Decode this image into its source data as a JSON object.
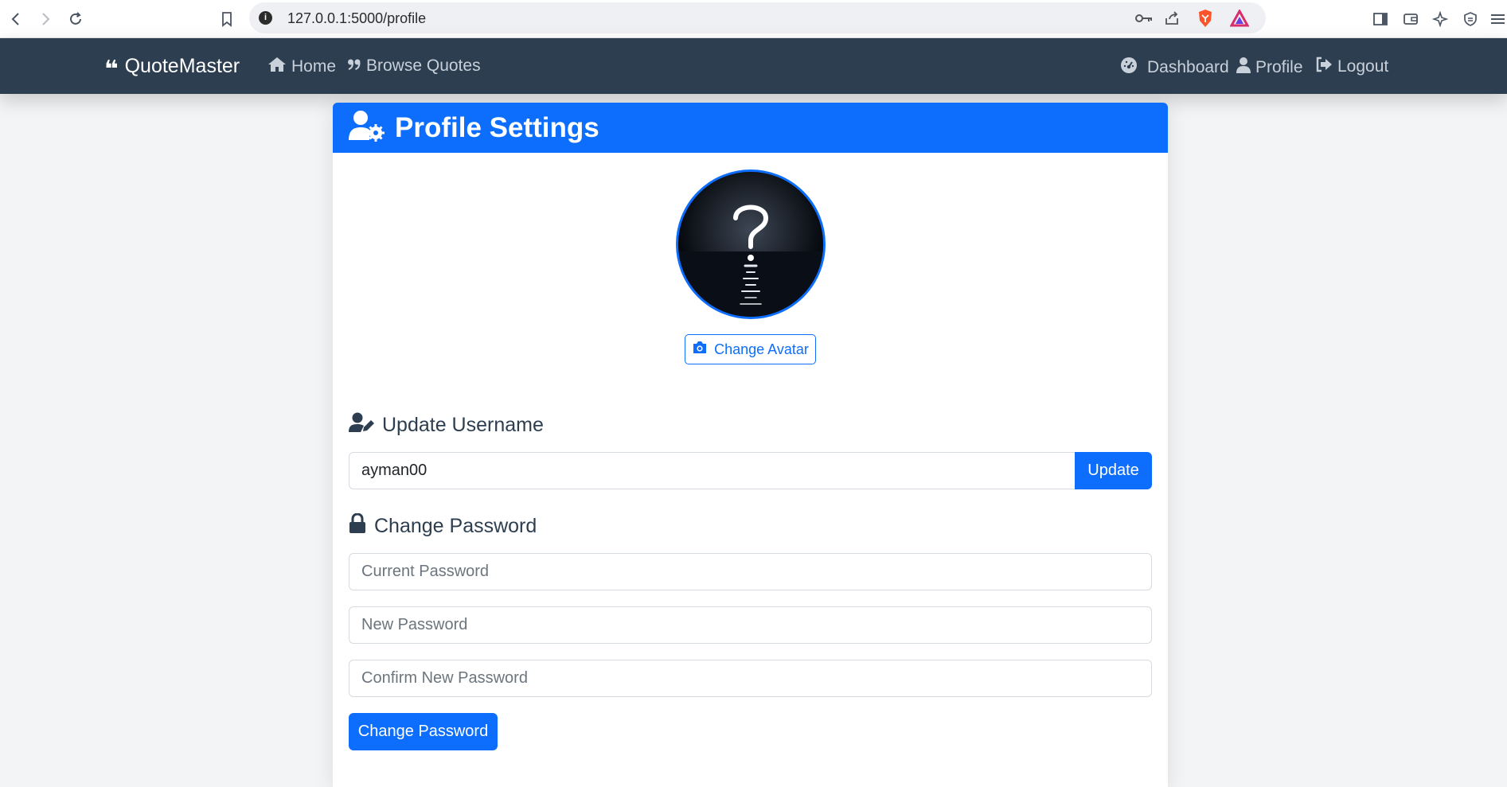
{
  "browser": {
    "url": "127.0.0.1:5000/profile",
    "info_glyph": "i"
  },
  "navbar": {
    "brand_glyph": "❝",
    "brand": "QuoteMaster",
    "links": [
      {
        "label": "Home",
        "icon": "home-icon"
      },
      {
        "label": "Browse Quotes",
        "icon": "quote-icon"
      }
    ],
    "right_links": [
      {
        "label": "Dashboard",
        "icon": "dashboard-icon"
      },
      {
        "label": "Profile",
        "icon": "user-icon"
      },
      {
        "label": "Logout",
        "icon": "logout-icon"
      }
    ]
  },
  "card": {
    "title": "Profile Settings",
    "avatar_button": "Change Avatar",
    "username_section": {
      "title": "Update Username",
      "value": "ayman00",
      "button": "Update"
    },
    "password_section": {
      "title": "Change Password",
      "current_placeholder": "Current Password",
      "new_placeholder": "New Password",
      "confirm_placeholder": "Confirm New Password",
      "button": "Change Password"
    }
  },
  "colors": {
    "navbar": "#2c3e50",
    "primary": "#0d6efd",
    "page_bg": "#f3f4f6"
  }
}
